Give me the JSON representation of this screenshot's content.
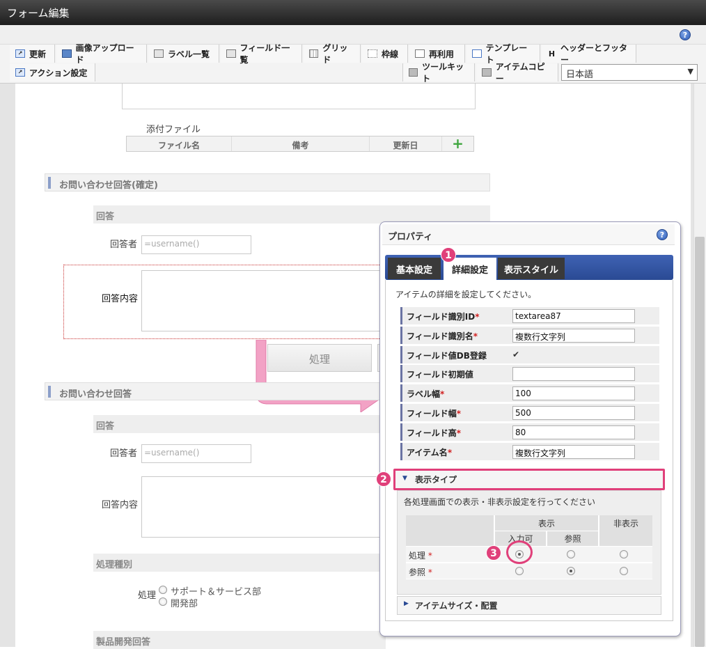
{
  "window": {
    "title": "フォーム編集"
  },
  "toolbar": {
    "update": "更新",
    "image_upload": "画像アップロード",
    "label_list": "ラベル一覧",
    "field_list": "フィールド一覧",
    "grid": "グリッド",
    "frame_line": "枠線",
    "reuse": "再利用",
    "template": "テンプレート",
    "header_footer": "ヘッダーとフッター",
    "action_settings": "アクション設定",
    "toolkit": "ツールキット",
    "item_copy": "アイテムコピー",
    "language": "日本語"
  },
  "form": {
    "attachment": {
      "label": "添付ファイル",
      "cols": [
        "ファイル名",
        "備考",
        "更新日"
      ]
    },
    "section1": {
      "title": "お問い合わせ回答(確定)",
      "subtitle": "回答",
      "responder_label": "回答者",
      "responder_value": "=username()",
      "content_label": "回答内容",
      "button": "処理"
    },
    "section2": {
      "title": "お問い合わせ回答",
      "subtitle": "回答",
      "responder_label": "回答者",
      "responder_value": "=username()",
      "content_label": "回答内容"
    },
    "process_type": {
      "title": "処理種別",
      "label": "処理",
      "options": [
        "サポート＆サービス部",
        "開発部"
      ]
    },
    "product_dev": {
      "title": "製品開発回答"
    }
  },
  "properties": {
    "title": "プロパティ",
    "tabs": [
      "基本設定",
      "詳細設定",
      "表示スタイル"
    ],
    "description": "アイテムの詳細を設定してください。",
    "rows": [
      {
        "label": "フィールド識別ID",
        "req": "*",
        "value": "textarea87"
      },
      {
        "label": "フィールド識別名",
        "req": "*",
        "value": "複数行文字列"
      },
      {
        "label": "フィールド値DB登録",
        "req": "",
        "value": "✔"
      },
      {
        "label": "フィールド初期値",
        "req": "",
        "value": ""
      },
      {
        "label": "ラベル幅",
        "req": "*",
        "value": "100"
      },
      {
        "label": "フィールド幅",
        "req": "*",
        "value": "500"
      },
      {
        "label": "フィールド高",
        "req": "*",
        "value": "80"
      },
      {
        "label": "アイテム名",
        "req": "*",
        "value": "複数行文字列"
      }
    ],
    "display_type": {
      "title": "表示タイプ",
      "description": "各処理画面での表示・非表示設定を行ってください",
      "col_show": "表示",
      "col_hide": "非表示",
      "col_input": "入力可",
      "col_ref": "参照",
      "rows": [
        {
          "label": "処理",
          "req": "*",
          "selected": "input"
        },
        {
          "label": "参照",
          "req": "*",
          "selected": "ref"
        }
      ]
    },
    "item_size": {
      "title": "アイテムサイズ・配置"
    }
  },
  "callouts": [
    "1",
    "2",
    "3"
  ],
  "colors": {
    "accent": "#e0407a",
    "tab_bar": "#2f4f9a"
  }
}
